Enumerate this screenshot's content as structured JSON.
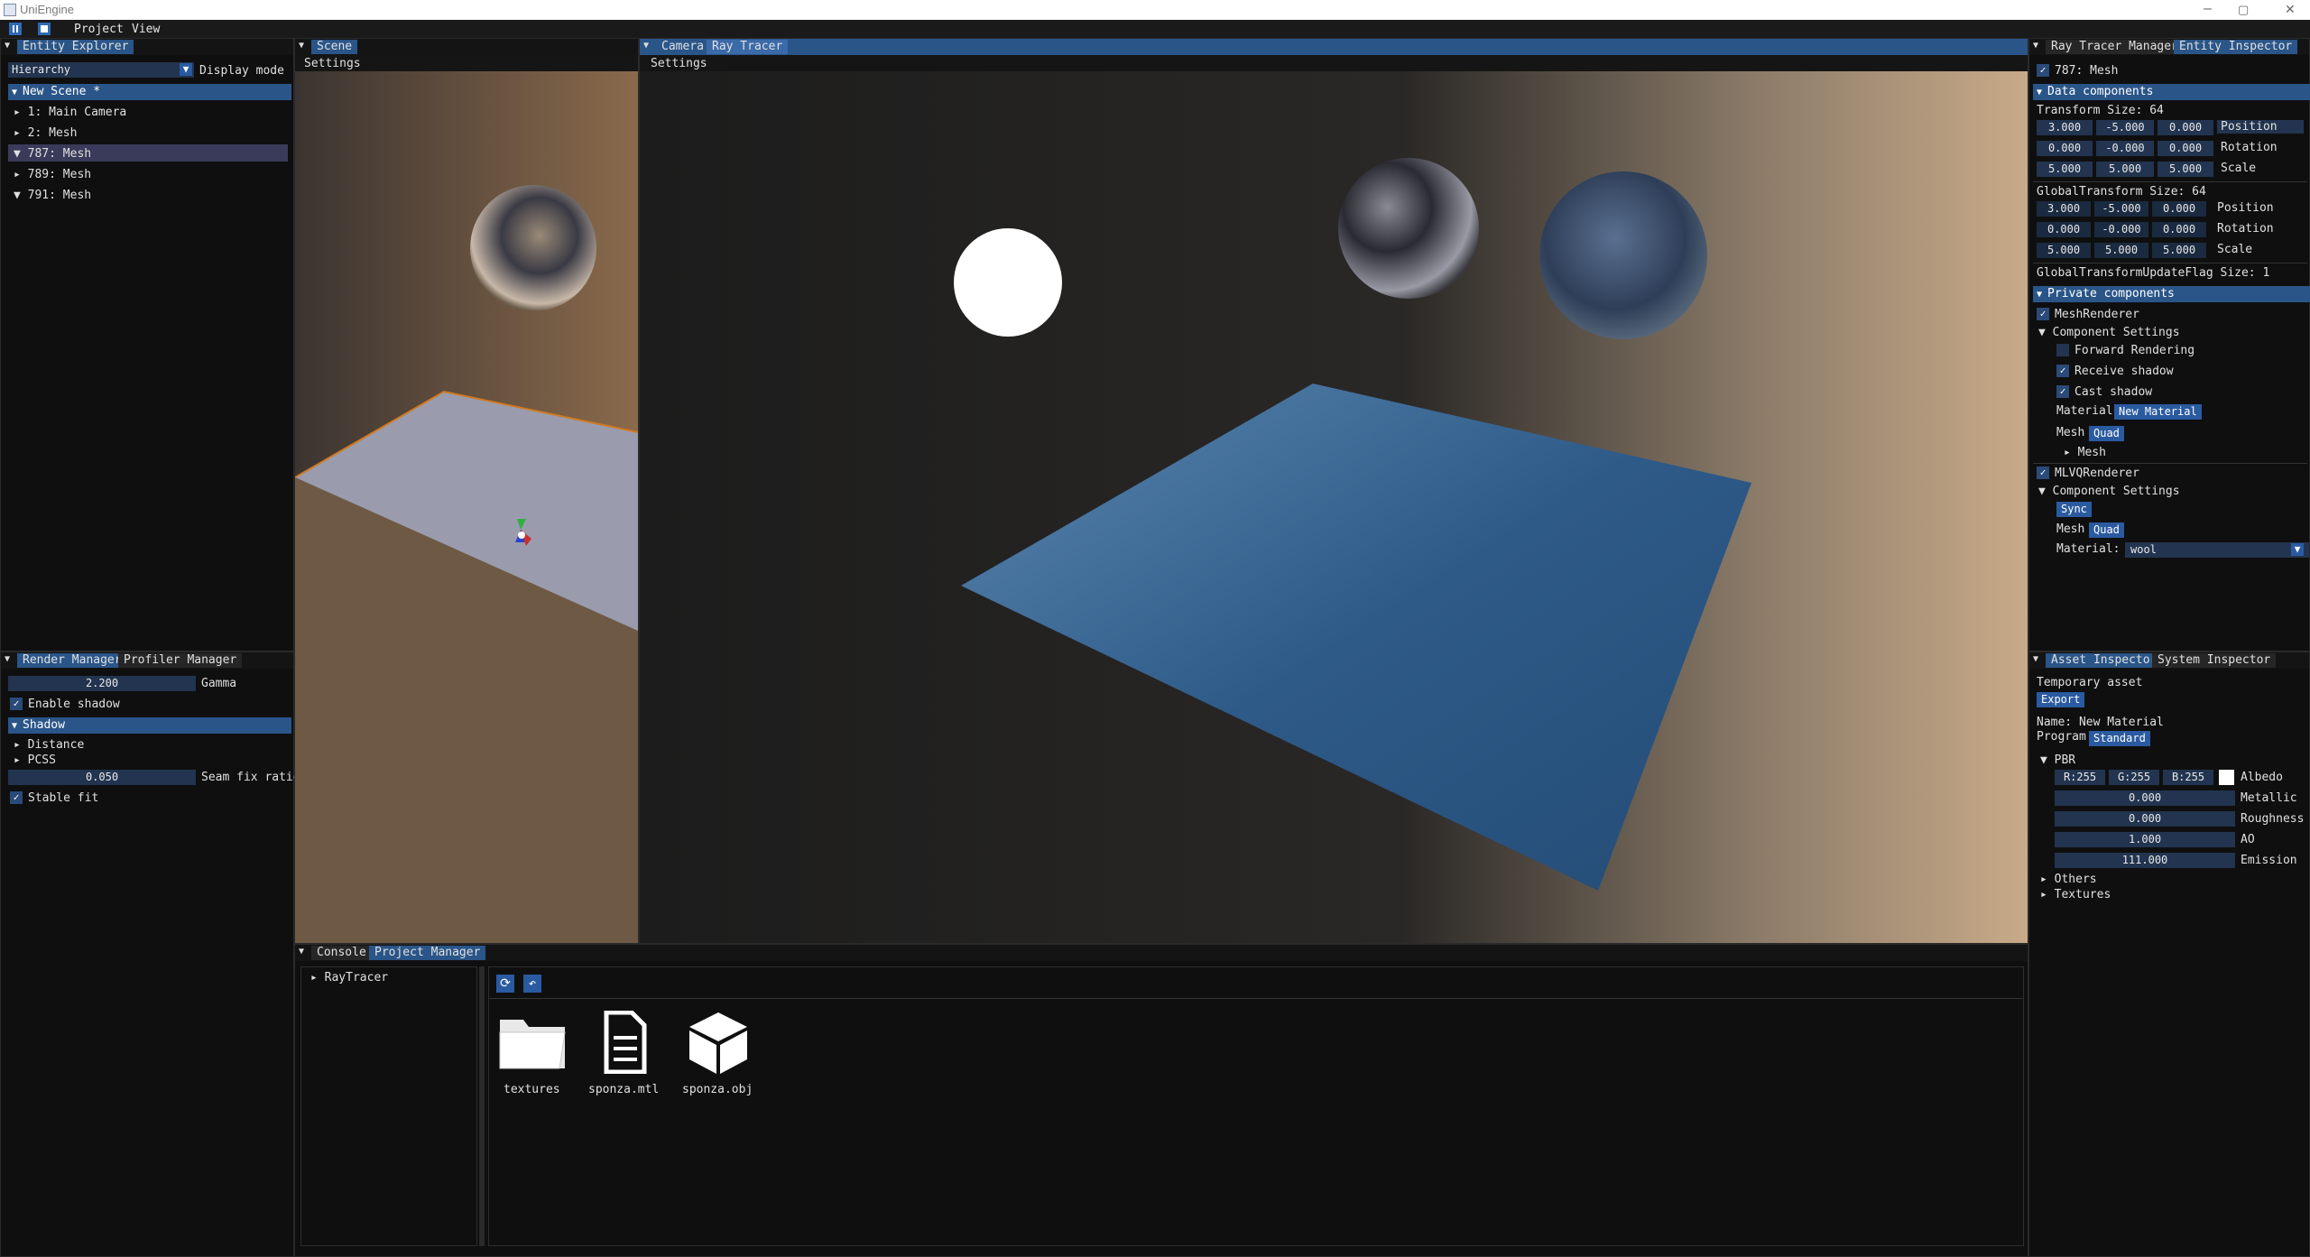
{
  "window": {
    "title": "UniEngine",
    "minimize": "–",
    "maximize": "▢",
    "close": "✕"
  },
  "menu": {
    "items": [
      "Project",
      "View"
    ]
  },
  "entity_explorer": {
    "tab": "Entity Explorer",
    "mode_value": "Hierarchy",
    "mode_label": "Display mode",
    "scene_label": "New Scene *",
    "entities": [
      "1: Main Camera",
      "2: Mesh",
      "787: Mesh",
      "789: Mesh",
      "791: Mesh"
    ]
  },
  "scene_view": {
    "tab": "Scene",
    "settings": "Settings"
  },
  "camera_view": {
    "tabs": [
      "Camera",
      "Ray Tracer"
    ],
    "settings": "Settings"
  },
  "render_manager": {
    "tabs": [
      "Render Manager",
      "Profiler Manager"
    ],
    "gamma_value": "2.200",
    "gamma_label": "Gamma",
    "enable_shadow": "Enable shadow",
    "shadow_header": "Shadow",
    "distance": "Distance",
    "pcss": "PCSS",
    "seam_value": "0.050",
    "seam_label": "Seam fix ratio",
    "stable_fit": "Stable fit"
  },
  "project_manager": {
    "tabs": [
      "Console",
      "Project Manager"
    ],
    "tree_root": "RayTracer",
    "files": [
      {
        "name": "textures",
        "icon": "folder-icon"
      },
      {
        "name": "sponza.mtl",
        "icon": "document-icon"
      },
      {
        "name": "sponza.obj",
        "icon": "cube-icon"
      }
    ]
  },
  "entity_inspector": {
    "tabs": [
      "Ray Tracer Manager",
      "Entity Inspector"
    ],
    "entity_name": "787: Mesh",
    "data_components": "Data components",
    "transform_label": "Transform Size: 64",
    "transform": {
      "position": [
        "3.000",
        "-5.000",
        "0.000"
      ],
      "rotation": [
        "0.000",
        "-0.000",
        "0.000"
      ],
      "scale": [
        "5.000",
        "5.000",
        "5.000"
      ]
    },
    "row_labels": {
      "position": "Position",
      "rotation": "Rotation",
      "scale": "Scale"
    },
    "global_label": "GlobalTransform Size: 64",
    "global": {
      "position": [
        "3.000",
        "-5.000",
        "0.000"
      ],
      "rotation": [
        "0.000",
        "-0.000",
        "0.000"
      ],
      "scale": [
        "5.000",
        "5.000",
        "5.000"
      ]
    },
    "update_flag": "GlobalTransformUpdateFlag Size: 1",
    "private_components": "Private components",
    "mesh_renderer": "MeshRenderer",
    "component_settings": "Component Settings",
    "forward_rendering": "Forward Rendering",
    "receive_shadow": "Receive shadow",
    "cast_shadow": "Cast shadow",
    "material_label": "Material",
    "material_value": "New Material",
    "mesh_label": "Mesh",
    "mesh_value": "Quad",
    "mesh_sub": "Mesh",
    "mlvq_renderer": "MLVQRenderer",
    "component_settings2": "Component Settings",
    "sync": "Sync",
    "mesh_label2": "Mesh",
    "mesh_value2": "Quad",
    "material_label2": "Material:",
    "material_value2": "wool"
  },
  "asset_inspector": {
    "tabs": [
      "Asset Inspector",
      "System Inspector"
    ],
    "temporary": "Temporary asset",
    "export": "Export",
    "name_label": "Name: New Material",
    "program_label": "Program",
    "program_value": "Standard",
    "pbr": "PBR",
    "albedo": [
      "R:255",
      "G:255",
      "B:255"
    ],
    "albedo_label": "Albedo",
    "albedo_color": "#ffffff",
    "metallic": "0.000",
    "metallic_label": "Metallic",
    "roughness": "0.000",
    "roughness_label": "Roughness",
    "ao": "1.000",
    "ao_label": "AO",
    "emission": "111.000",
    "emission_label": "Emission",
    "others": "Others",
    "textures": "Textures"
  }
}
